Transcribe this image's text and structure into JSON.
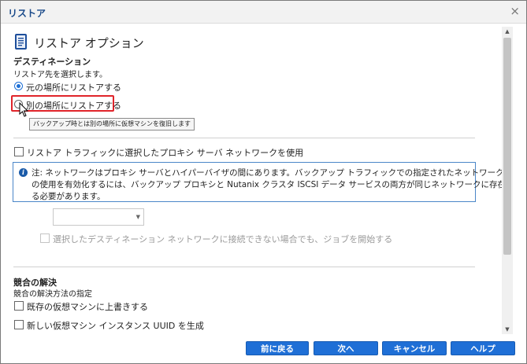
{
  "window": {
    "title": "リストア",
    "close_glyph": "×"
  },
  "header": {
    "title": "リストア オプション"
  },
  "destination": {
    "section_title": "デスティネーション",
    "instruction": "リストア先を選択します。",
    "option_original": "元の場所にリストアする",
    "option_alternate": "別の場所にリストアする",
    "selected": "original",
    "tooltip": "バックアップ時とは別の場所に仮想マシンを復旧します"
  },
  "network": {
    "proxy_checkbox_label": "リストア トラフィックに選択したプロキシ サーバ ネットワークを使用",
    "proxy_checked": false,
    "note_line1": "注: ネットワークはプロキシ サーバとハイパーバイザの間にあります。バックアップ トラフィックでの指定されたネットワーク",
    "note_line2": "の使用を有効化するには、バックアップ プロキシと Nutanix クラスタ ISCSI データ サービスの両方が同じネットワークに存在す",
    "note_line3": "る必要があります。",
    "dropdown_value": "",
    "start_job_label": "選択したデスティネーション ネットワークに接続できない場合でも、ジョブを開始する",
    "start_job_checked": false
  },
  "conflict": {
    "section_title": "競合の解決",
    "instruction": "競合の解決方法の指定",
    "overwrite_label": "既存の仮想マシンに上書きする",
    "overwrite_checked": false,
    "new_uuid_label": "新しい仮想マシン インスタンス UUID を生成",
    "new_uuid_checked": false
  },
  "footer": {
    "back_label": "前に戻る",
    "next_label": "次へ",
    "cancel_label": "キャンセル",
    "help_label": "ヘルプ"
  },
  "colors": {
    "accent": "#1f6fd6",
    "highlight": "#e0242a",
    "title_text": "#1a4a8a"
  }
}
